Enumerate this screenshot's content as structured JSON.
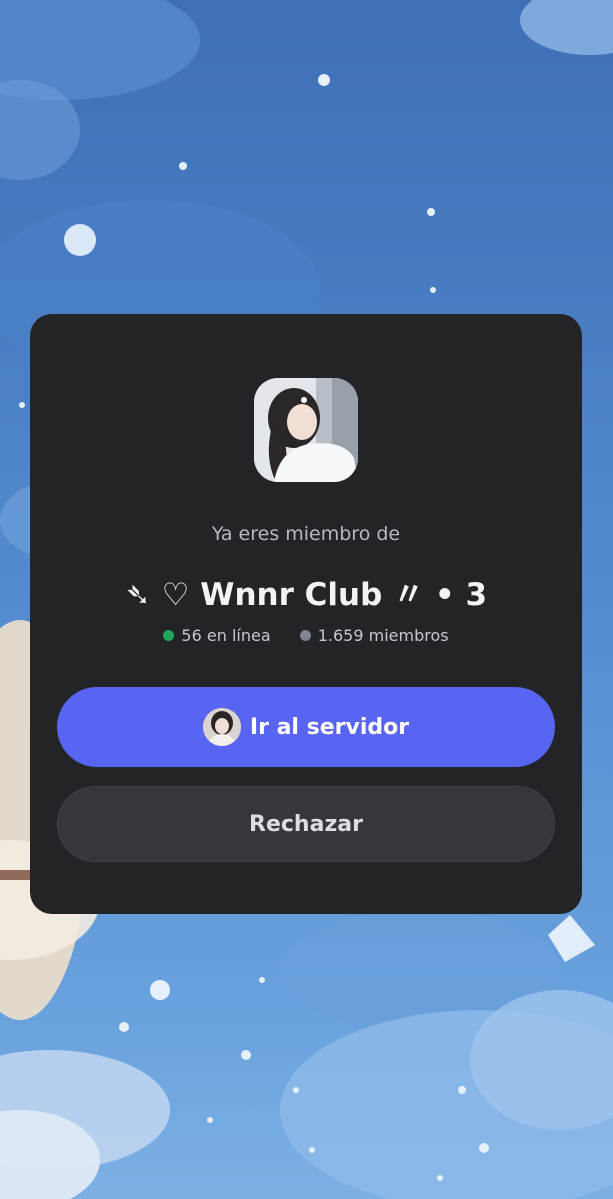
{
  "invite": {
    "subtitle": "Ya eres miembro de",
    "server_name": "➴ ♡ Wnnr Club 〃 • 3",
    "online_count": "56 en línea",
    "member_count": "1.659 miembros"
  },
  "actions": {
    "go_to_server_label": "Ir al servidor",
    "decline_label": "Rechazar"
  },
  "icons": {
    "server": "server-avatar-icon",
    "online": "online-status-dot-icon",
    "members": "members-status-dot-icon",
    "user": "user-avatar-icon"
  },
  "colors": {
    "card_background": "#232428",
    "primary_button": "#5865f2",
    "secondary_button": "#35373c",
    "online_status": "#23a55a",
    "members_status": "#80848e",
    "background_blue": "#4a7fc4"
  }
}
